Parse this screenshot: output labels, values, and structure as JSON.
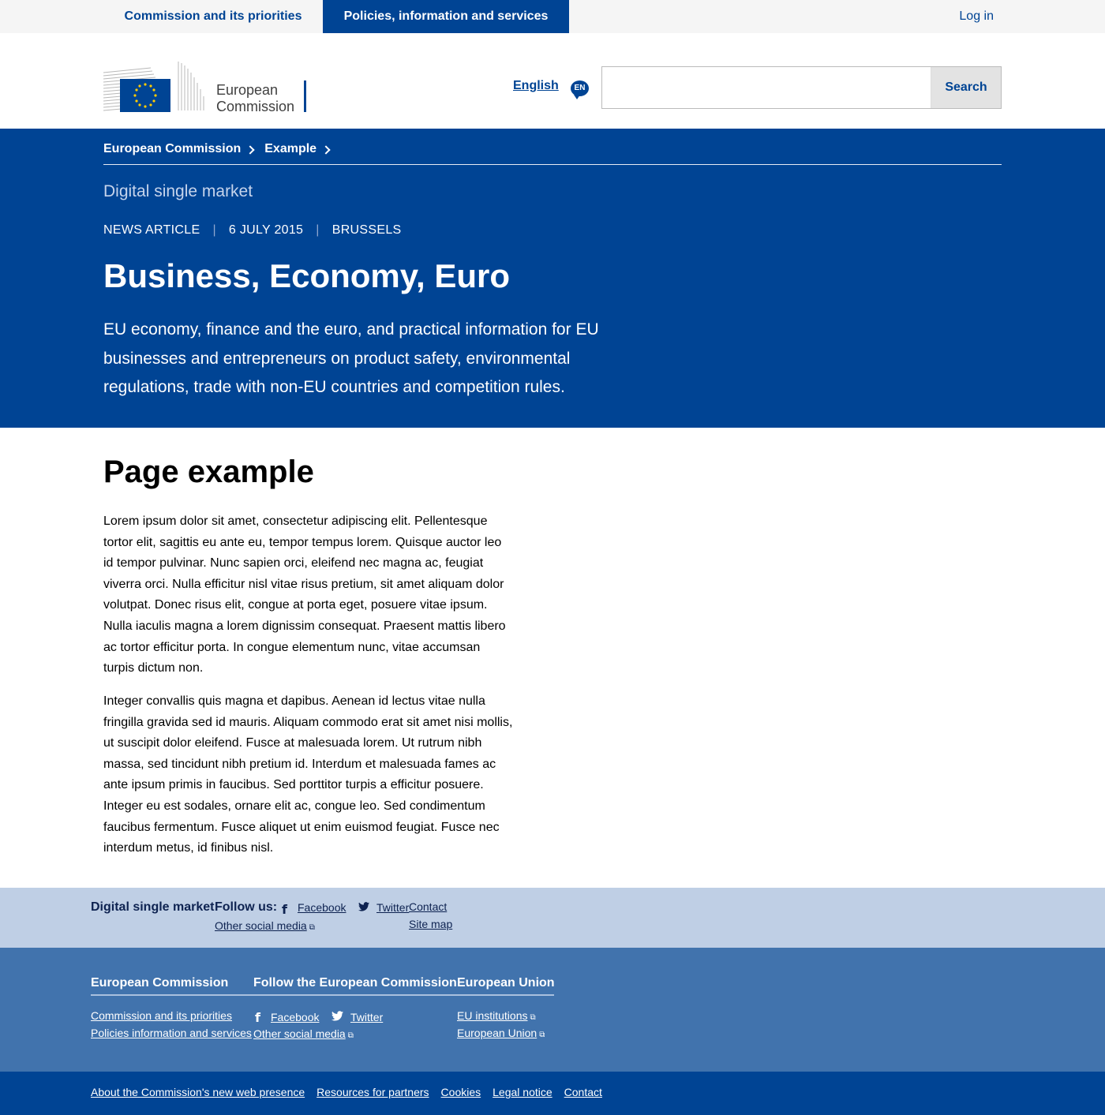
{
  "topnav": {
    "items": [
      {
        "label": "Commission and its priorities"
      },
      {
        "label": "Policies, information and services"
      }
    ],
    "login": "Log in"
  },
  "header": {
    "logo_text_line1": "European",
    "logo_text_line2": "Commission",
    "language": "English",
    "language_code": "EN",
    "search": {
      "placeholder": "",
      "value": "",
      "button": "Search"
    }
  },
  "hero": {
    "breadcrumb": [
      "European Commission",
      "Example"
    ],
    "site_name": "Digital single market",
    "meta": [
      "NEWS ARTICLE",
      "6 JULY 2015",
      "BRUSSELS"
    ],
    "meta_sep": "|",
    "title": "Business, Economy, Euro",
    "intro": "EU economy, finance and the euro, and practical information for EU businesses and entrepreneurs on product safety, environmental regulations, trade with non-EU countries and competition rules."
  },
  "content": {
    "title": "Page example",
    "paragraphs": [
      "Lorem ipsum dolor sit amet, consectetur adipiscing elit. Pellentesque tortor elit, sagittis eu ante eu, tempor tempus lorem. Quisque auctor leo id tempor pulvinar. Nunc sapien orci, eleifend nec magna ac, feugiat viverra orci. Nulla efficitur nisl vitae risus pretium, sit amet aliquam dolor volutpat. Donec risus elit, congue at porta eget, posuere vitae ipsum. Nulla iaculis magna a lorem dignissim consequat. Praesent mattis libero ac tortor efficitur porta. In congue elementum nunc, vitae accumsan turpis dictum non.",
      "Integer convallis quis magna et dapibus. Aenean id lectus vitae nulla fringilla gravida sed id mauris. Aliquam commodo erat sit amet nisi mollis, ut suscipit dolor eleifend. Fusce at malesuada lorem. Ut rutrum nibh massa, sed tincidunt nibh pretium id. Interdum et malesuada fames ac ante ipsum primis in faucibus. Sed porttitor turpis a efficitur posuere. Integer eu est sodales, ornare elit ac, congue leo. Sed condimentum faucibus fermentum. Fusce aliquet ut enim euismod feugiat. Fusce nec interdum metus, id finibus nisl."
    ]
  },
  "footer_light": {
    "site_name": "Digital single market",
    "follow_label": "Follow us:",
    "facebook": "Facebook",
    "twitter": "Twitter",
    "other_social": "Other social media",
    "contact": "Contact",
    "site_map": "Site map"
  },
  "footer_mid": {
    "col1_title": "European Commission",
    "col1_links": [
      "Commission and its priorities",
      "Policies information and services"
    ],
    "col2_title": "Follow the European Commission",
    "facebook": "Facebook",
    "twitter": "Twitter",
    "other_social": "Other social media",
    "col3_title": "European Union",
    "col3_links": [
      "EU institutions",
      "European Union"
    ]
  },
  "footer_bottom": {
    "links": [
      "About the Commission's new web presence",
      "Resources for partners",
      "Cookies",
      "Legal notice",
      "Contact"
    ]
  },
  "colors": {
    "primary": "#004494",
    "footer_light": "#bfcfe5",
    "footer_mid": "#4173ad",
    "eu_star": "#ffcc00"
  }
}
